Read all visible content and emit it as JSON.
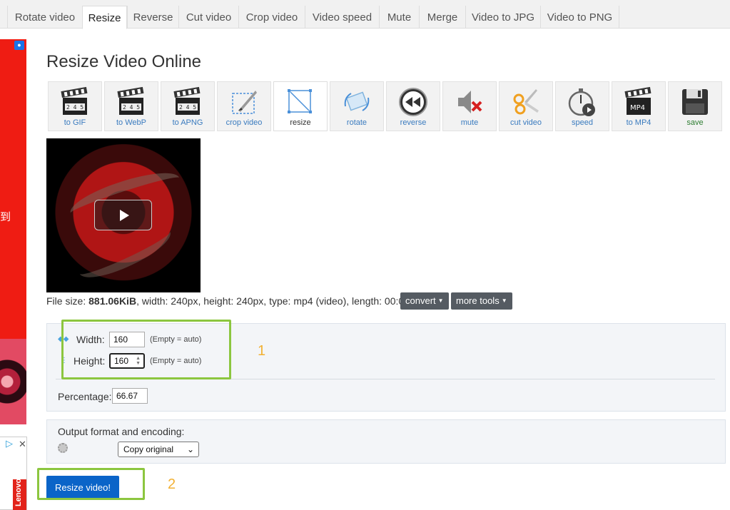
{
  "tabs": [
    {
      "label": "Rotate video",
      "active": false
    },
    {
      "label": "Resize",
      "active": true
    },
    {
      "label": "Reverse",
      "active": false
    },
    {
      "label": "Cut video",
      "active": false
    },
    {
      "label": "Crop video",
      "active": false
    },
    {
      "label": "Video speed",
      "active": false
    },
    {
      "label": "Mute",
      "active": false
    },
    {
      "label": "Merge",
      "active": false
    },
    {
      "label": "Video to JPG",
      "active": false
    },
    {
      "label": "Video to PNG",
      "active": false
    }
  ],
  "page_title": "Resize Video Online",
  "toolbar": [
    {
      "label": "to GIF",
      "icon": "clapperboard-icon"
    },
    {
      "label": "to WebP",
      "icon": "clapperboard-icon"
    },
    {
      "label": "to APNG",
      "icon": "clapperboard-icon"
    },
    {
      "label": "crop video",
      "icon": "crop-icon"
    },
    {
      "label": "resize",
      "icon": "resize-icon",
      "active": true
    },
    {
      "label": "rotate",
      "icon": "rotate-icon"
    },
    {
      "label": "reverse",
      "icon": "rewind-icon"
    },
    {
      "label": "mute",
      "icon": "mute-icon"
    },
    {
      "label": "cut video",
      "icon": "scissors-icon"
    },
    {
      "label": "speed",
      "icon": "stopwatch-icon"
    },
    {
      "label": "to MP4",
      "icon": "mp4-clapperboard-icon",
      "badge": "MP4"
    },
    {
      "label": "save",
      "icon": "floppy-disk-icon"
    }
  ],
  "file_info": {
    "prefix": "File size: ",
    "size": "881.06KiB",
    "rest": ", width: 240px, height: 240px, type: mp4 (video), length: 00:00:12"
  },
  "buttons": {
    "convert": "convert",
    "more_tools": "more tools",
    "resize_video": "Resize video!"
  },
  "size_form": {
    "width_label": "Width:",
    "width_value": "160",
    "width_hint": "(Empty = auto)",
    "height_label": "Height:",
    "height_value": "160",
    "height_hint": "(Empty = auto)",
    "percentage_label": "Percentage:",
    "percentage_value": "66.67"
  },
  "output": {
    "label": "Output format and encoding:",
    "selected": "Copy original"
  },
  "annotations": {
    "one": "1",
    "two": "2",
    "highlight_color": "#8cc63f",
    "number_color": "#f2b134"
  },
  "ad": {
    "side_char": "到",
    "brand": "Lenovo",
    "choices_icon": "ad-choices-icon",
    "close_icon": "close-icon",
    "badge_icon": "user-badge-icon"
  },
  "colors": {
    "primary": "#0a64c8",
    "dropdown": "#555b62",
    "link": "#3a7bbf"
  }
}
